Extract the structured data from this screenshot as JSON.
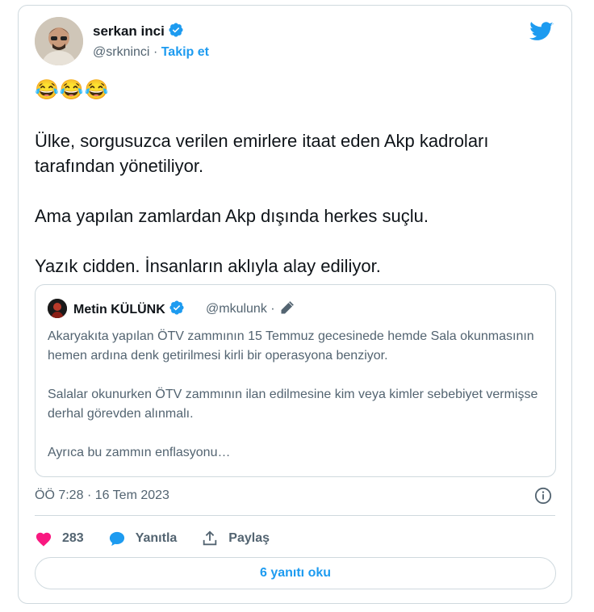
{
  "author": {
    "name": "serkan inci",
    "handle": "@srkninci",
    "separator": "·",
    "follow_label": "Takip et"
  },
  "emojis": "😂😂😂",
  "tweet_text": "Ülke, sorgusuzca verilen emirlere itaat eden Akp kadroları tarafından yönetiliyor.\n\nAma yapılan zamlardan Akp dışında herkes suçlu.\n\nYazık cidden. İnsanların aklıyla alay ediliyor.",
  "quote": {
    "name": "Metin KÜLÜNK",
    "handle": "@mkulunk",
    "separator": "·",
    "text": "Akaryakıta yapılan ÖTV zammının 15 Temmuz gecesinede hemde Sala okunmasının hemen ardına denk getirilmesi kirli bir operasyona benziyor.\n\nSalalar okunurken ÖTV zammının ilan edilmesine kim veya kimler sebebiyet vermişse derhal görevden alınmalı.\n\nAyrıca bu zammın enflasyonu…"
  },
  "meta": {
    "time": "ÖÖ 7:28",
    "separator": "·",
    "date": "16 Tem 2023"
  },
  "actions": {
    "like_count": "283",
    "reply_label": "Yanıtla",
    "share_label": "Paylaş"
  },
  "replies_button": "6 yanıtı oku",
  "colors": {
    "accent": "#1d9bf0",
    "like": "#f91880",
    "muted": "#536471",
    "border": "#cfd9de"
  },
  "icons": [
    "verified-badge-icon",
    "twitter-bird-icon",
    "pencil-icon",
    "info-icon",
    "heart-icon",
    "reply-bubble-icon",
    "share-icon"
  ]
}
